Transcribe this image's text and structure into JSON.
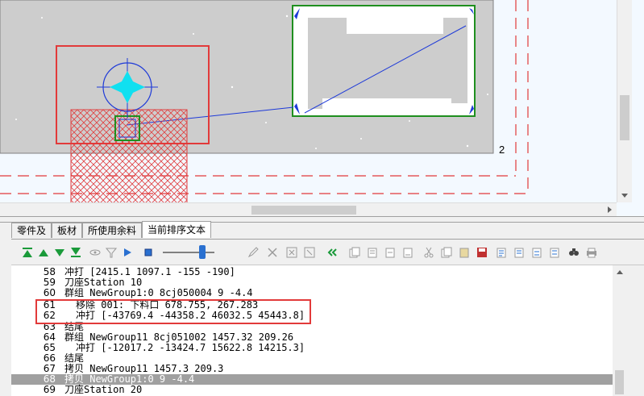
{
  "canvas": {
    "part_number_label": "2"
  },
  "tabs": [
    {
      "label": "零件及",
      "active": false
    },
    {
      "label": "板材",
      "active": false
    },
    {
      "label": "所使用余料",
      "active": false
    },
    {
      "label": "当前排序文本",
      "active": true
    }
  ],
  "toolbar": {
    "icons": [
      "move-top-icon",
      "move-up-icon",
      "move-down-icon",
      "move-bottom-icon",
      "eye-icon",
      "filter-icon",
      "play-icon",
      "stop-icon",
      "slider-icon",
      "edit-icon",
      "delete-icon",
      "delete-group-icon",
      "clear-icon",
      "back-icon",
      "copy-icon",
      "paste-icon",
      "undo-icon",
      "redo-icon",
      "cut-icon",
      "copy2-icon",
      "paste2-icon",
      "save-icon",
      "list-icon",
      "list2-icon",
      "list3-icon",
      "list4-icon",
      "find-icon",
      "print-icon"
    ]
  },
  "lines": [
    {
      "num": "58",
      "text": "冲打 [2415.1 1097.1 -155 -190]",
      "indent": false,
      "selected": false
    },
    {
      "num": "59",
      "text": "刀座Station 10",
      "indent": false,
      "selected": false
    },
    {
      "num": "60",
      "text": "群组 NewGroup1:0 8cj050004 9 -4.4",
      "indent": false,
      "selected": false
    },
    {
      "num": "61",
      "text": "移除 001: 下料口 678.755, 267.283",
      "indent": true,
      "selected": false
    },
    {
      "num": "62",
      "text": "冲打 [-43769.4 -44358.2 46032.5 45443.8]",
      "indent": true,
      "selected": false
    },
    {
      "num": "63",
      "text": "结尾",
      "indent": false,
      "selected": false
    },
    {
      "num": "64",
      "text": "群组 NewGroup11 8cj051002 1457.32 209.26",
      "indent": false,
      "selected": false
    },
    {
      "num": "65",
      "text": "冲打 [-12017.2 -13424.7 15622.8 14215.3]",
      "indent": true,
      "selected": false
    },
    {
      "num": "66",
      "text": "结尾",
      "indent": false,
      "selected": false
    },
    {
      "num": "67",
      "text": "拷贝 NewGroup11 1457.3 209.3",
      "indent": false,
      "selected": false
    },
    {
      "num": "68",
      "text": "拷贝 NewGroup1:0 9 -4.4",
      "indent": false,
      "selected": true
    },
    {
      "num": "69",
      "text": "刀座Station 20",
      "indent": false,
      "selected": false
    }
  ]
}
